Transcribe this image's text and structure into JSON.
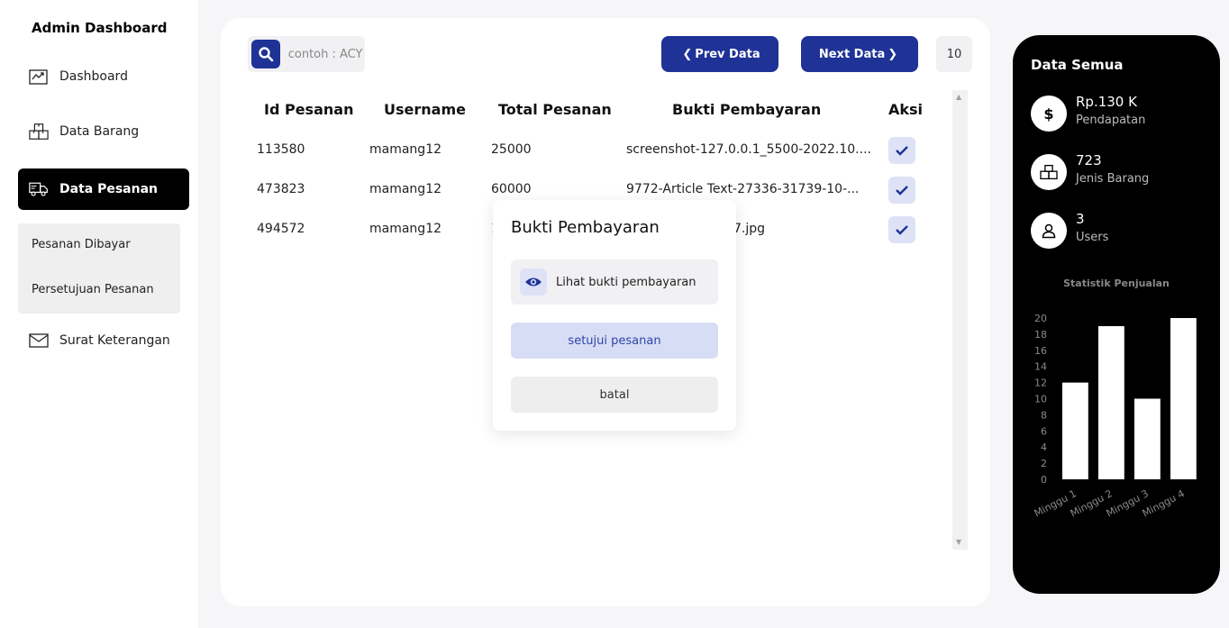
{
  "sidebar": {
    "brand": "Admin Dashboard",
    "items": [
      {
        "label": "Dashboard",
        "icon": "chart-line-icon"
      },
      {
        "label": "Data Barang",
        "icon": "boxes-icon"
      },
      {
        "label": "Data Pesanan",
        "icon": "truck-icon",
        "active": true
      },
      {
        "label": "Surat Keterangan",
        "icon": "envelope-icon"
      }
    ],
    "submenu": [
      "Pesanan Dibayar",
      "Persetujuan Pesanan"
    ]
  },
  "toolbar": {
    "search_placeholder": "contoh : ACY",
    "prev_label": "Prev Data",
    "next_label": "Next Data",
    "per_page": "10"
  },
  "table": {
    "columns": [
      "Id Pesanan",
      "Username",
      "Total Pesanan",
      "Bukti Pembayaran",
      "Aksi"
    ],
    "rows": [
      {
        "id": "113580",
        "username": "mamang12",
        "total": "25000",
        "bukti": "screenshot-127.0.0.1_5500-2022.10...."
      },
      {
        "id": "473823",
        "username": "mamang12",
        "total": "60000",
        "bukti": "9772-Article Text-27336-31739-10-..."
      },
      {
        "id": "494572",
        "username": "mamang12",
        "total": "1",
        "bukti": "7.jpg"
      }
    ]
  },
  "popup": {
    "title": "Bukti Pembayaran",
    "view_label": "Lihat bukti pembayaran",
    "approve_label": "setujui pesanan",
    "cancel_label": "batal"
  },
  "stats": {
    "title": "Data Semua",
    "items": [
      {
        "value": "Rp.130 K",
        "label": "Pendapatan",
        "icon": "dollar-icon"
      },
      {
        "value": "723",
        "label": "Jenis Barang",
        "icon": "boxes-icon"
      },
      {
        "value": "3",
        "label": "Users",
        "icon": "user-icon"
      }
    ]
  },
  "chart_data": {
    "type": "bar",
    "title": "Statistik Penjualan",
    "categories": [
      "Minggu 1",
      "Minggu 2",
      "Minggu 3",
      "Minggu 4"
    ],
    "values": [
      12,
      19,
      10,
      20
    ],
    "ylim": [
      0,
      20
    ],
    "yticks": [
      0,
      2,
      4,
      6,
      8,
      10,
      12,
      14,
      16,
      18,
      20
    ],
    "bar_color": "#ffffff",
    "grid": false
  },
  "colors": {
    "accent": "#1f3296",
    "accent_light": "#dde2f6",
    "panel_dark": "#000000"
  }
}
